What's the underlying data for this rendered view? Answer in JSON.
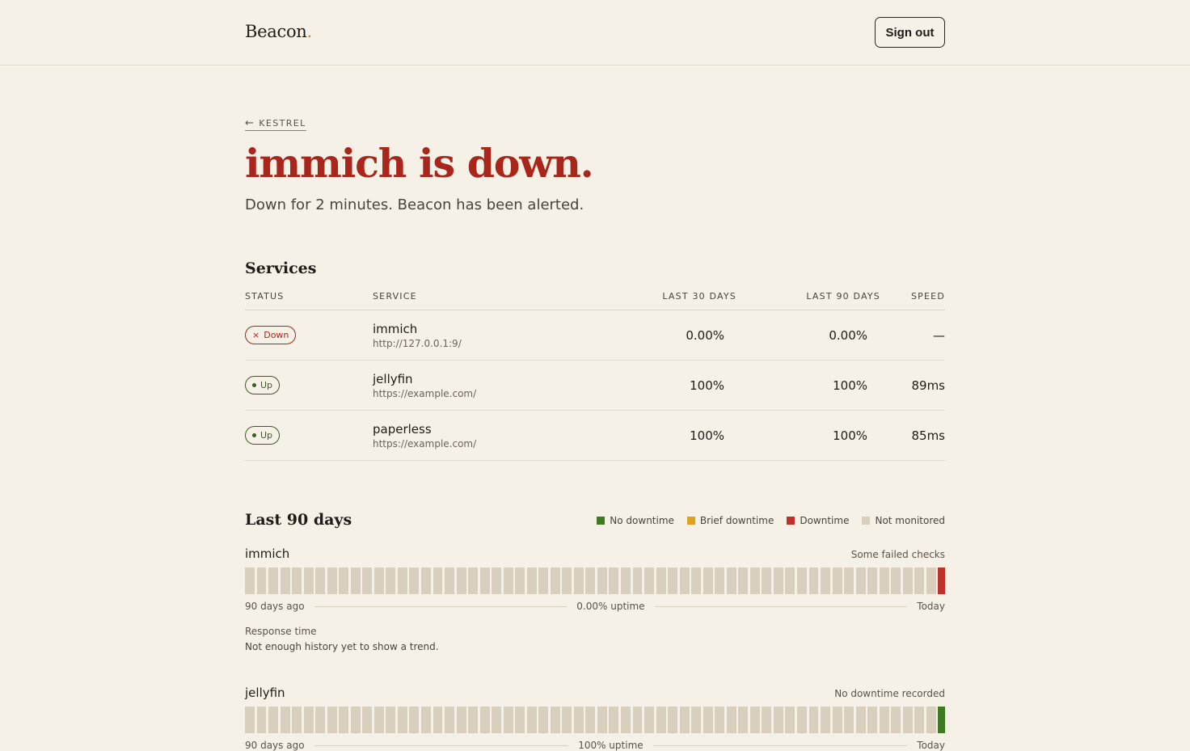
{
  "header": {
    "brand": "Beacon",
    "brand_dot": ".",
    "signout_label": "Sign out"
  },
  "breadcrumb": {
    "arrow": "←",
    "label": "KESTREL"
  },
  "hero": {
    "title": "immich is down.",
    "subtitle": "Down for 2 minutes. Beacon has been alerted."
  },
  "services": {
    "title": "Services",
    "columns": {
      "status": "STATUS",
      "service": "SERVICE",
      "last30": "LAST 30 DAYS",
      "last90": "LAST 90 DAYS",
      "speed": "SPEED"
    },
    "rows": [
      {
        "status": "Down",
        "status_icon": "×",
        "name": "immich",
        "url": "http://127.0.0.1:9/",
        "last30": "0.00%",
        "last90": "0.00%",
        "speed": "—"
      },
      {
        "status": "Up",
        "name": "jellyfin",
        "url": "https://example.com/",
        "last30": "100%",
        "last90": "100%",
        "speed": "89ms"
      },
      {
        "status": "Up",
        "name": "paperless",
        "url": "https://example.com/",
        "last30": "100%",
        "last90": "100%",
        "speed": "85ms"
      }
    ]
  },
  "history": {
    "title": "Last 90 days",
    "legend": [
      {
        "label": "No downtime",
        "color": "#3e7a22"
      },
      {
        "label": "Brief downtime",
        "color": "#e0a020"
      },
      {
        "label": "Downtime",
        "color": "#c0312a"
      },
      {
        "label": "Not monitored",
        "color": "#d8cfbf"
      }
    ],
    "items": [
      {
        "name": "immich",
        "note": "Some failed checks",
        "start": "90 days ago",
        "uptime": "0.00% uptime",
        "end": "Today",
        "last_color": "#c0312a",
        "rt_label": "Response time",
        "rt_text": "Not enough history yet to show a trend."
      },
      {
        "name": "jellyfin",
        "note": "No downtime recorded",
        "start": "90 days ago",
        "uptime": "100% uptime",
        "end": "Today",
        "last_color": "#3e7a22"
      }
    ]
  }
}
